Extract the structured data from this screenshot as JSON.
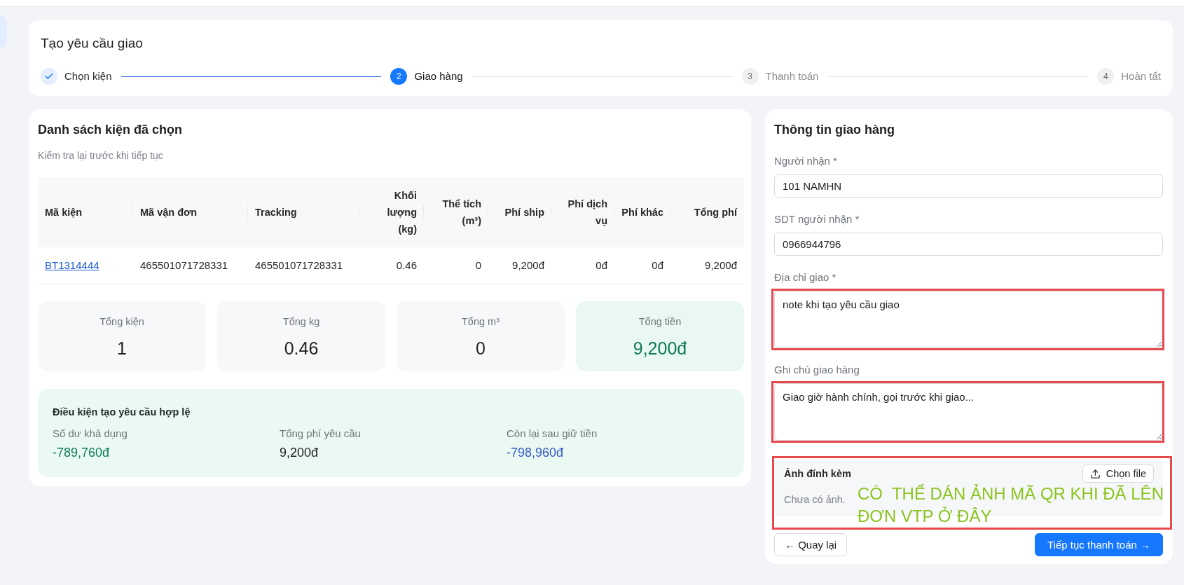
{
  "page": {
    "title": "Tạo yêu cầu giao"
  },
  "steps": [
    {
      "label": "Chọn kiện",
      "done": true,
      "selected": false
    },
    {
      "number": "2",
      "label": "Giao hàng",
      "done": false,
      "selected": true
    },
    {
      "number": "3",
      "label": "Thanh toán",
      "done": false,
      "selected": false
    },
    {
      "number": "4",
      "label": "Hoàn tất",
      "done": false,
      "selected": false
    }
  ],
  "package_list": {
    "title": "Danh sách kiện đã chọn",
    "subtitle": "Kiểm tra lại trước khi tiếp tục",
    "table": {
      "columns": [
        {
          "label": "Mã kiện",
          "kind": "link"
        },
        {
          "label": "Mã vận đơn",
          "kind": "text"
        },
        {
          "label": "Tracking",
          "kind": "text"
        },
        {
          "label": "Khối lượng (kg)",
          "kind": "number"
        },
        {
          "label": "Thể tích (m³)",
          "kind": "number"
        },
        {
          "label": "Phí ship",
          "kind": "number"
        },
        {
          "label": "Phí dịch vụ",
          "kind": "number"
        },
        {
          "label": "Phí khác",
          "kind": "number"
        },
        {
          "label": "Tổng phí",
          "kind": "number"
        }
      ],
      "rows": [
        [
          "BT1314444",
          "465501071728331",
          "465501071728331",
          "0.46",
          "0",
          "9,200đ",
          "0đ",
          "0đ",
          "9,200đ"
        ]
      ]
    },
    "totals": [
      {
        "label": "Tổng kiện",
        "value": "1",
        "highlight": false
      },
      {
        "label": "Tổng kg",
        "value": "0.46",
        "highlight": false
      },
      {
        "label": "Tổng m³",
        "value": "0",
        "highlight": false
      },
      {
        "label": "Tổng tiền",
        "value": "9,200đ",
        "highlight": true
      }
    ],
    "conditions": {
      "title": "Điều kiện tạo yêu cầu hợp lệ",
      "items": [
        {
          "label": "Số dư khả dụng",
          "value": "-789,760đ",
          "color": "#0e7a58"
        },
        {
          "label": "Tổng phí yêu cầu",
          "value": "9,200đ",
          "color": "#1f1f1f"
        },
        {
          "label": "Còn lại sau giữ tiền",
          "value": "-798,960đ",
          "color": "#3556c8"
        }
      ]
    }
  },
  "delivery": {
    "title": "Thông tin giao hàng",
    "fields": [
      {
        "label": "Người nhận *",
        "value": "101 NAMHN",
        "kind": "input",
        "highlighted": false
      },
      {
        "label": "SDT người nhận *",
        "value": "0966944796",
        "kind": "input",
        "highlighted": false
      },
      {
        "label": "Địa chỉ giao *",
        "value": "note khi tạo yêu cầu giao",
        "kind": "textarea",
        "highlighted": true
      },
      {
        "label": "Ghi chú giao hàng",
        "value": "Giao giờ hành chính, gọi trước khi giao...",
        "kind": "textarea",
        "highlighted": true
      }
    ],
    "attachment": {
      "title": "Ảnh đính kèm",
      "button": "Chọn file",
      "empty_text": "Chưa có ảnh.",
      "highlighted": true,
      "note": "CÓ  THỂ DÁN ẢNH MÃ QR KHI ĐÃ LÊN ĐƠN VTP Ở ĐÂY"
    },
    "buttons": [
      {
        "label": "← Quay lại",
        "kind": "secondary"
      },
      {
        "label": "Tiếp tục thanh toán →",
        "kind": "primary"
      }
    ]
  }
}
